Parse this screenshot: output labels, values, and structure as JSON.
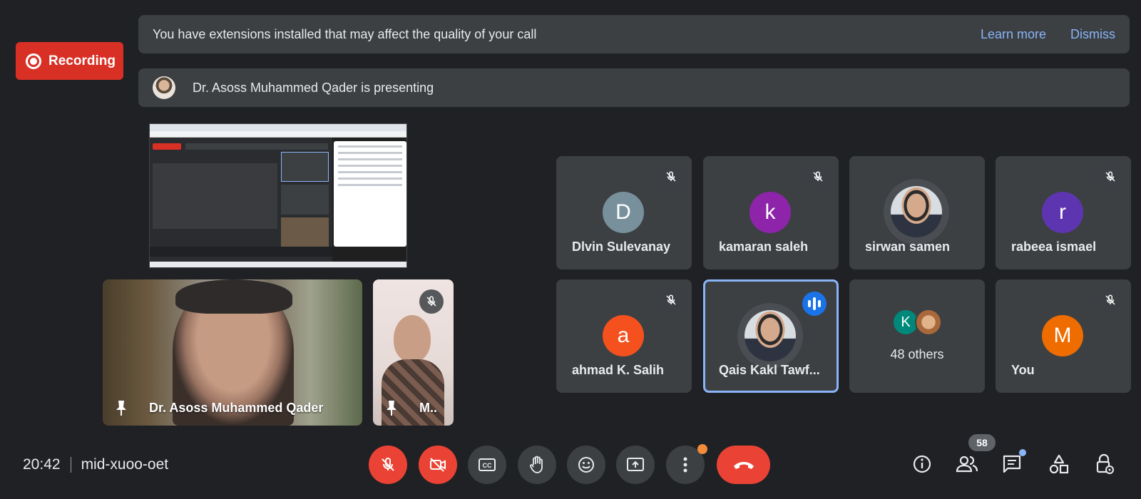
{
  "recording": {
    "label": "Recording",
    "color": "#d93025"
  },
  "banners": {
    "extensions": {
      "message": "You have extensions installed that may affect the quality of your call",
      "learn_more": "Learn more",
      "dismiss": "Dismiss"
    },
    "presenting": {
      "message": "Dr. Asoss Muhammed Qader is presenting"
    }
  },
  "videos": [
    {
      "name": "Dr. Asoss Muhammed Qader",
      "pinned": true
    },
    {
      "name": "M..",
      "pinned": true,
      "muted": true
    }
  ],
  "tiles": [
    {
      "name": "Dlvin Sulevanay",
      "initial": "D",
      "color": "#78909c",
      "muted": true
    },
    {
      "name": "kamaran saleh",
      "initial": "k",
      "color": "#8e24aa",
      "muted": true
    },
    {
      "name": "sirwan samen",
      "photo": true,
      "muted": false
    },
    {
      "name": "rabeea ismael",
      "initial": "r",
      "color": "#5e35b1",
      "muted": true
    },
    {
      "name": "ahmad K. Salih",
      "initial": "a",
      "color": "#f4511e",
      "muted": true
    },
    {
      "name": "Qais Kakl Tawf...",
      "photo": true,
      "speaking": true
    },
    {
      "others_label": "48 others",
      "mini_initial": "K",
      "mini_color": "#00897b"
    },
    {
      "name": "You",
      "initial": "M",
      "color": "#ef6c00",
      "muted": true
    }
  ],
  "bottom_bar": {
    "time": "20:42",
    "meeting_code": "mid-xuoo-oet",
    "participant_count": "58",
    "accent": "#ea4335"
  },
  "icons": [
    "mic-off-icon",
    "camera-off-icon",
    "captions-icon",
    "raise-hand-icon",
    "emoji-icon",
    "present-screen-icon",
    "more-options-icon",
    "end-call-icon",
    "info-icon",
    "people-icon",
    "chat-icon",
    "activities-icon",
    "host-controls-icon"
  ]
}
